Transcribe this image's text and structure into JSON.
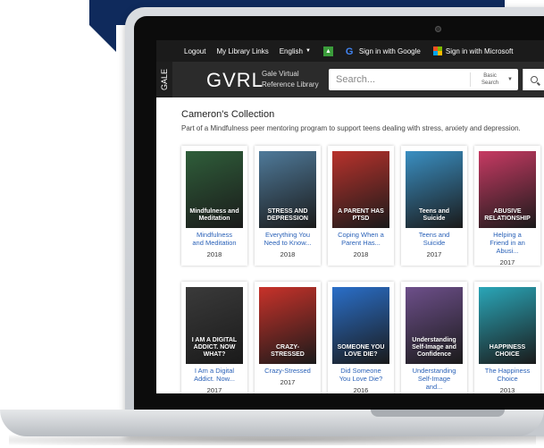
{
  "colors": {
    "banner": "#0f2a5c",
    "topbar": "#1b1b1b",
    "header": "#2b2b2b",
    "link": "#2b62b8"
  },
  "topbar": {
    "logout": "Logout",
    "my_library_links": "My Library Links",
    "language": "English",
    "google_signin": "Sign in with Google",
    "microsoft_signin": "Sign in with Microsoft"
  },
  "header": {
    "gale": "GALE",
    "brand": "GVRL",
    "brand_sub_1": "Gale Virtual",
    "brand_sub_2": "Reference Library",
    "search_placeholder": "Search...",
    "search_type_1": "Basic",
    "search_type_2": "Search"
  },
  "collection": {
    "title": "Cameron's Collection",
    "description": "Part of a Mindfulness peer mentoring program to support teens dealing with stress, anxiety and depression."
  },
  "books": [
    {
      "title_1": "Mindfulness",
      "title_2": "and Meditation",
      "title_3": "",
      "year": "2018",
      "cover_text": "Mindfulness and Meditation",
      "cover_color": "#2f5e3a"
    },
    {
      "title_1": "Everything You",
      "title_2": "Need to Know...",
      "title_3": "",
      "year": "2018",
      "cover_text": "STRESS AND DEPRESSION",
      "cover_color": "#4f7a9a"
    },
    {
      "title_1": "Coping When a",
      "title_2": "Parent Has...",
      "title_3": "",
      "year": "2018",
      "cover_text": "A PARENT HAS PTSD",
      "cover_color": "#b8322c"
    },
    {
      "title_1": "Teens and",
      "title_2": "Suicide",
      "title_3": "",
      "year": "2017",
      "cover_text": "Teens and Suicide",
      "cover_color": "#3a8fc2"
    },
    {
      "title_1": "Helping a",
      "title_2": "Friend in an",
      "title_3": "Abusi...",
      "year": "2017",
      "cover_text": "ABUSIVE RELATIONSHIP",
      "cover_color": "#c73a63"
    },
    {
      "title_1": "I Am a Digital",
      "title_2": "Addict. Now...",
      "title_3": "",
      "year": "2017",
      "cover_text": "I AM A DIGITAL ADDICT. NOW WHAT?",
      "cover_color": "#3a3a3a"
    },
    {
      "title_1": "Crazy-Stressed",
      "title_2": "",
      "title_3": "",
      "year": "2017",
      "cover_text": "CRAZY-STRESSED",
      "cover_color": "#c8322a"
    },
    {
      "title_1": "Did Someone",
      "title_2": "You Love Die?",
      "title_3": "",
      "year": "2016",
      "cover_text": "SOMEONE YOU LOVE DIE?",
      "cover_color": "#2a6fc9"
    },
    {
      "title_1": "Understanding",
      "title_2": "Self-Image",
      "title_3": "and...",
      "year": "",
      "cover_text": "Understanding Self-Image and Confidence",
      "cover_color": "#6d4f8a"
    },
    {
      "title_1": "The Happiness",
      "title_2": "Choice",
      "title_3": "",
      "year": "2013",
      "cover_text": "HAPPINESS CHOICE",
      "cover_color": "#2aa6b8"
    }
  ]
}
